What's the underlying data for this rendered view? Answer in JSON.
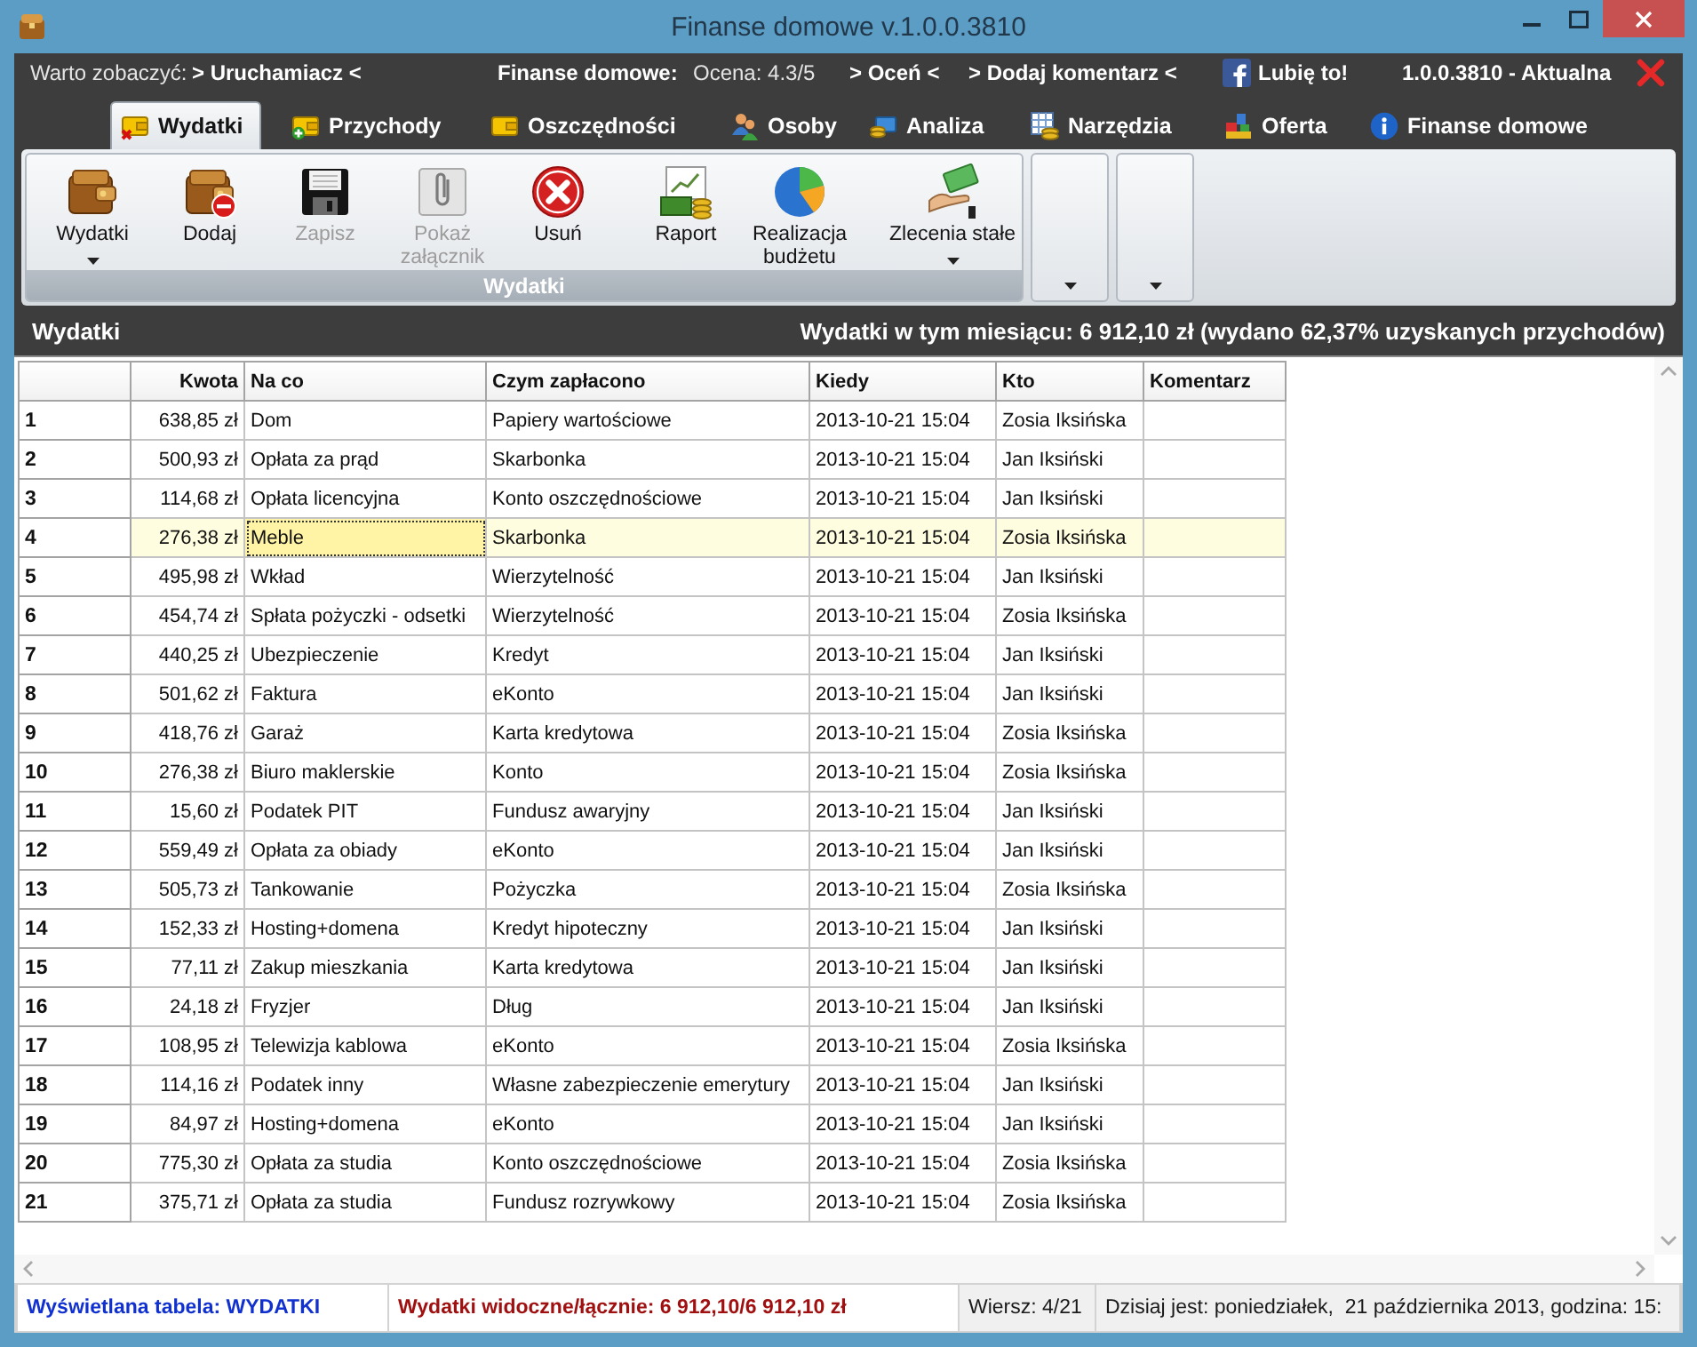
{
  "window": {
    "title": "Finanse domowe v.1.0.0.3810"
  },
  "info_bar": [
    {
      "kind": "label",
      "text": "Warto zobaczyć:"
    },
    {
      "kind": "link",
      "text": "> Uruchamiacz <"
    },
    {
      "kind": "heading",
      "text": "Finanse domowe:"
    },
    {
      "kind": "label",
      "text": "Ocena: 4.3/5"
    },
    {
      "kind": "link",
      "text": "> Oceń <"
    },
    {
      "kind": "link",
      "text": "> Dodaj komentarz <"
    },
    {
      "kind": "facebook",
      "text": "Lubię to!"
    },
    {
      "kind": "heading",
      "text": "1.0.0.3810 - Aktualna"
    }
  ],
  "tabs": [
    {
      "label": "Wydatki",
      "selected": true
    },
    {
      "label": "Przychody",
      "selected": false
    },
    {
      "label": "Oszczędności",
      "selected": false
    },
    {
      "label": "Osoby",
      "selected": false
    },
    {
      "label": "Analiza",
      "selected": false
    },
    {
      "label": "Narzędzia",
      "selected": false
    },
    {
      "label": "Oferta",
      "selected": false
    },
    {
      "label": "Finanse domowe",
      "selected": false
    }
  ],
  "ribbon": {
    "group_label": "Wydatki",
    "sections": [
      {
        "buttons": [
          {
            "label": "Wydatki",
            "dropdown": true,
            "disabled": false
          },
          {
            "label": "Dodaj",
            "dropdown": false,
            "disabled": false
          },
          {
            "label": "Zapisz",
            "dropdown": false,
            "disabled": true
          },
          {
            "label": "Pokaż załącznik",
            "dropdown": false,
            "disabled": true
          },
          {
            "label": "Usuń",
            "dropdown": false,
            "disabled": false
          }
        ]
      },
      {
        "buttons": [
          {
            "label": "Raport",
            "dropdown": false,
            "disabled": false
          },
          {
            "label": "Realizacja budżetu",
            "dropdown": false,
            "disabled": false
          }
        ]
      },
      {
        "buttons": [
          {
            "label": "Zlecenia stałe",
            "dropdown": true,
            "disabled": false
          }
        ]
      }
    ]
  },
  "section_header": {
    "title": "Wydatki",
    "summary": "Wydatki w tym miesiącu: 6 912,10 zł (wydano 62,37% uzyskanych przychodów)"
  },
  "table": {
    "columns": [
      "Kwota",
      "Na co",
      "Czym zapłacono",
      "Kiedy",
      "Kto",
      "Komentarz"
    ],
    "rows": [
      {
        "number": "1",
        "selected": false,
        "cells": [
          {
            "text": "638,85 zł",
            "focused": false
          },
          {
            "text": "Dom",
            "focused": false
          },
          {
            "text": "Papiery wartościowe",
            "focused": false
          },
          {
            "text": "2013-10-21 15:04",
            "focused": false
          },
          {
            "text": "Zosia Iksińska",
            "focused": false
          }
        ]
      },
      {
        "number": "2",
        "selected": false,
        "cells": [
          {
            "text": "500,93 zł",
            "focused": false
          },
          {
            "text": "Opłata za prąd",
            "focused": false
          },
          {
            "text": "Skarbonka",
            "focused": false
          },
          {
            "text": "2013-10-21 15:04",
            "focused": false
          },
          {
            "text": "Jan Iksiński",
            "focused": false
          }
        ]
      },
      {
        "number": "3",
        "selected": false,
        "cells": [
          {
            "text": "114,68 zł",
            "focused": false
          },
          {
            "text": "Opłata licencyjna",
            "focused": false
          },
          {
            "text": "Konto oszczędnościowe",
            "focused": false
          },
          {
            "text": "2013-10-21 15:04",
            "focused": false
          },
          {
            "text": "Jan Iksiński",
            "focused": false
          }
        ]
      },
      {
        "number": "4",
        "selected": true,
        "cells": [
          {
            "text": "276,38 zł",
            "focused": false
          },
          {
            "text": "Meble",
            "focused": true
          },
          {
            "text": "Skarbonka",
            "focused": false
          },
          {
            "text": "2013-10-21 15:04",
            "focused": false
          },
          {
            "text": "Zosia Iksińska",
            "focused": false
          }
        ]
      },
      {
        "number": "5",
        "selected": false,
        "cells": [
          {
            "text": "495,98 zł",
            "focused": false
          },
          {
            "text": "Wkład",
            "focused": false
          },
          {
            "text": "Wierzytelność",
            "focused": false
          },
          {
            "text": "2013-10-21 15:04",
            "focused": false
          },
          {
            "text": "Jan Iksiński",
            "focused": false
          }
        ]
      },
      {
        "number": "6",
        "selected": false,
        "cells": [
          {
            "text": "454,74 zł",
            "focused": false
          },
          {
            "text": "Spłata pożyczki - odsetki",
            "focused": false
          },
          {
            "text": "Wierzytelność",
            "focused": false
          },
          {
            "text": "2013-10-21 15:04",
            "focused": false
          },
          {
            "text": "Zosia Iksińska",
            "focused": false
          }
        ]
      },
      {
        "number": "7",
        "selected": false,
        "cells": [
          {
            "text": "440,25 zł",
            "focused": false
          },
          {
            "text": "Ubezpieczenie",
            "focused": false
          },
          {
            "text": "Kredyt",
            "focused": false
          },
          {
            "text": "2013-10-21 15:04",
            "focused": false
          },
          {
            "text": "Jan Iksiński",
            "focused": false
          }
        ]
      },
      {
        "number": "8",
        "selected": false,
        "cells": [
          {
            "text": "501,62 zł",
            "focused": false
          },
          {
            "text": "Faktura",
            "focused": false
          },
          {
            "text": "eKonto",
            "focused": false
          },
          {
            "text": "2013-10-21 15:04",
            "focused": false
          },
          {
            "text": "Jan Iksiński",
            "focused": false
          }
        ]
      },
      {
        "number": "9",
        "selected": false,
        "cells": [
          {
            "text": "418,76 zł",
            "focused": false
          },
          {
            "text": "Garaż",
            "focused": false
          },
          {
            "text": "Karta kredytowa",
            "focused": false
          },
          {
            "text": "2013-10-21 15:04",
            "focused": false
          },
          {
            "text": "Zosia Iksińska",
            "focused": false
          }
        ]
      },
      {
        "number": "10",
        "selected": false,
        "cells": [
          {
            "text": "276,38 zł",
            "focused": false
          },
          {
            "text": "Biuro maklerskie",
            "focused": false
          },
          {
            "text": "Konto",
            "focused": false
          },
          {
            "text": "2013-10-21 15:04",
            "focused": false
          },
          {
            "text": "Zosia Iksińska",
            "focused": false
          }
        ]
      },
      {
        "number": "11",
        "selected": false,
        "cells": [
          {
            "text": "15,60 zł",
            "focused": false
          },
          {
            "text": "Podatek PIT",
            "focused": false
          },
          {
            "text": "Fundusz awaryjny",
            "focused": false
          },
          {
            "text": "2013-10-21 15:04",
            "focused": false
          },
          {
            "text": "Jan Iksiński",
            "focused": false
          }
        ]
      },
      {
        "number": "12",
        "selected": false,
        "cells": [
          {
            "text": "559,49 zł",
            "focused": false
          },
          {
            "text": "Opłata za obiady",
            "focused": false
          },
          {
            "text": "eKonto",
            "focused": false
          },
          {
            "text": "2013-10-21 15:04",
            "focused": false
          },
          {
            "text": "Jan Iksiński",
            "focused": false
          }
        ]
      },
      {
        "number": "13",
        "selected": false,
        "cells": [
          {
            "text": "505,73 zł",
            "focused": false
          },
          {
            "text": "Tankowanie",
            "focused": false
          },
          {
            "text": "Pożyczka",
            "focused": false
          },
          {
            "text": "2013-10-21 15:04",
            "focused": false
          },
          {
            "text": "Zosia Iksińska",
            "focused": false
          }
        ]
      },
      {
        "number": "14",
        "selected": false,
        "cells": [
          {
            "text": "152,33 zł",
            "focused": false
          },
          {
            "text": "Hosting+domena",
            "focused": false
          },
          {
            "text": "Kredyt hipoteczny",
            "focused": false
          },
          {
            "text": "2013-10-21 15:04",
            "focused": false
          },
          {
            "text": "Jan Iksiński",
            "focused": false
          }
        ]
      },
      {
        "number": "15",
        "selected": false,
        "cells": [
          {
            "text": "77,11 zł",
            "focused": false
          },
          {
            "text": "Zakup mieszkania",
            "focused": false
          },
          {
            "text": "Karta kredytowa",
            "focused": false
          },
          {
            "text": "2013-10-21 15:04",
            "focused": false
          },
          {
            "text": "Jan Iksiński",
            "focused": false
          }
        ]
      },
      {
        "number": "16",
        "selected": false,
        "cells": [
          {
            "text": "24,18 zł",
            "focused": false
          },
          {
            "text": "Fryzjer",
            "focused": false
          },
          {
            "text": "Dług",
            "focused": false
          },
          {
            "text": "2013-10-21 15:04",
            "focused": false
          },
          {
            "text": "Jan Iksiński",
            "focused": false
          }
        ]
      },
      {
        "number": "17",
        "selected": false,
        "cells": [
          {
            "text": "108,95 zł",
            "focused": false
          },
          {
            "text": "Telewizja kablowa",
            "focused": false
          },
          {
            "text": "eKonto",
            "focused": false
          },
          {
            "text": "2013-10-21 15:04",
            "focused": false
          },
          {
            "text": "Zosia Iksińska",
            "focused": false
          }
        ]
      },
      {
        "number": "18",
        "selected": false,
        "cells": [
          {
            "text": "114,16 zł",
            "focused": false
          },
          {
            "text": "Podatek inny",
            "focused": false
          },
          {
            "text": "Własne zabezpieczenie emerytury",
            "focused": false
          },
          {
            "text": "2013-10-21 15:04",
            "focused": false
          },
          {
            "text": "Jan Iksiński",
            "focused": false
          }
        ]
      },
      {
        "number": "19",
        "selected": false,
        "cells": [
          {
            "text": "84,97 zł",
            "focused": false
          },
          {
            "text": "Hosting+domena",
            "focused": false
          },
          {
            "text": "eKonto",
            "focused": false
          },
          {
            "text": "2013-10-21 15:04",
            "focused": false
          },
          {
            "text": "Jan Iksiński",
            "focused": false
          }
        ]
      },
      {
        "number": "20",
        "selected": false,
        "cells": [
          {
            "text": "775,30 zł",
            "focused": false
          },
          {
            "text": "Opłata za studia",
            "focused": false
          },
          {
            "text": "Konto oszczędnościowe",
            "focused": false
          },
          {
            "text": "2013-10-21 15:04",
            "focused": false
          },
          {
            "text": "Zosia Iksińska",
            "focused": false
          }
        ]
      },
      {
        "number": "21",
        "selected": false,
        "cells": [
          {
            "text": "375,71 zł",
            "focused": false
          },
          {
            "text": "Opłata za studia",
            "focused": false
          },
          {
            "text": "Fundusz rozrywkowy",
            "focused": false
          },
          {
            "text": "2013-10-21 15:04",
            "focused": false
          },
          {
            "text": "Zosia Iksińska",
            "focused": false
          }
        ]
      }
    ]
  },
  "status_bar": [
    {
      "kind": "table",
      "text": "Wyświetlana tabela: WYDATKI"
    },
    {
      "kind": "total",
      "text": "Wydatki widoczne/łącznie: 6 912,10/6 912,10 zł"
    },
    {
      "kind": "plain",
      "text": "Wiersz: 4/21"
    },
    {
      "kind": "plain",
      "text": "Dzisiaj jest: poniedziałek,  21 października 2013, godzina: 15:"
    }
  ]
}
